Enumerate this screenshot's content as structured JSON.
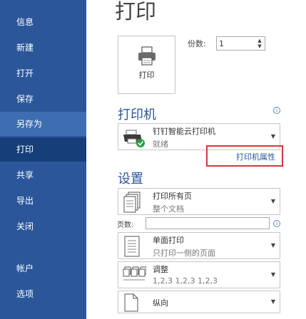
{
  "sidebar": {
    "items": [
      {
        "label": "信息"
      },
      {
        "label": "新建"
      },
      {
        "label": "打开"
      },
      {
        "label": "保存"
      },
      {
        "label": "另存为"
      },
      {
        "label": "打印"
      },
      {
        "label": "共享"
      },
      {
        "label": "导出"
      },
      {
        "label": "关闭"
      },
      {
        "label": "帐户"
      },
      {
        "label": "选项"
      }
    ],
    "active": "打印",
    "colors": {
      "background": "#2b579a",
      "active": "#163f7a",
      "hover": "#3e6db1"
    }
  },
  "main": {
    "title": "打印",
    "print_button": {
      "label": "打印",
      "icon": "printer-icon"
    },
    "copies": {
      "label": "份数:",
      "value": "1"
    },
    "printer_section": {
      "heading": "打印机",
      "printer_name": "钉钉智能云打印机",
      "printer_status": "就绪",
      "properties_link": "打印机属性"
    },
    "settings_section": {
      "heading": "设置",
      "print_what": {
        "main": "打印所有页",
        "sub": "整个文档"
      },
      "pages": {
        "label": "页数:",
        "value": ""
      },
      "sides": {
        "main": "单面打印",
        "sub": "只打印一侧的页面"
      },
      "collation": {
        "main": "调整",
        "sub": "1,2,3    1,2,3    1,2,3"
      },
      "orientation": {
        "main": "纵向"
      }
    },
    "colors": {
      "accent": "#2b579a",
      "highlight_border": "#d9353a"
    }
  }
}
